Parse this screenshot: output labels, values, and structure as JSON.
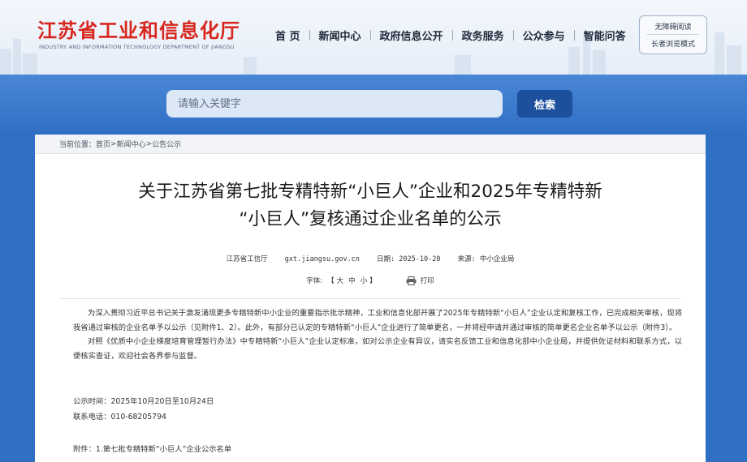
{
  "header": {
    "title": "江苏省工业和信息化厅",
    "subtitle": "INDUSTRY AND INFORMATION TECHNOLOGY DEPARTMENT OF JIANGSU",
    "nav": [
      "首 页",
      "新闻中心",
      "政府信息公开",
      "政务服务",
      "公众参与",
      "智能问答"
    ],
    "accessibility": {
      "barrier_free": "无障碍阅读",
      "elder_mode": "长者浏览模式"
    }
  },
  "search": {
    "placeholder": "请输入关键字",
    "button": "检索"
  },
  "breadcrumb": {
    "label": "当前位置：",
    "items": [
      "首页",
      "新闻中心",
      "公告公示"
    ],
    "separator": ">"
  },
  "article": {
    "title_line1": "关于江苏省第七批专精特新“小巨人”企业和2025年专精特新",
    "title_line2": "“小巨人”复核通过企业名单的公示",
    "source": "江苏省工信厅",
    "site": "gxt.jiangsu.gov.cn",
    "date": "日期: 2025-10-20",
    "origin": "来源: 中小企业局",
    "font_label": "字体:",
    "font_sizes": [
      "大",
      "中",
      "小"
    ],
    "print": "打印",
    "paragraph1": "为深入贯彻习近平总书记关于激发涌现更多专精特新中小企业的重要指示批示精神，工业和信息化部开展了2025年专精特新“小巨人”企业认定和复核工作，已完成相关审核，现将我省通过审核的企业名单予以公示（见附件1、2）。此外，有部分已认定的专精特新“小巨人”企业进行了简单更名，一并将经申请并通过审核的简单更名企业名单予以公示（附件3）。",
    "paragraph2": "对照《优质中小企业梯度培育管理暂行办法》中专精特新“小巨人”企业认定标准，如对公示企业有异议，请实名反馈工业和信息化部中小企业局，并提供佐证材料和联系方式，以便核实查证，欢迎社会各界参与监督。",
    "notice_period": "公示时间：2025年10月20日至10月24日",
    "phone": "联系电话：010-68205794",
    "attachment": "附件：1.第七批专精特新“小巨人”企业公示名单"
  },
  "colors": {
    "brand_red": "#d7261e",
    "band_blue": "#2f6fc4",
    "button_navy": "#1c4f9c"
  }
}
